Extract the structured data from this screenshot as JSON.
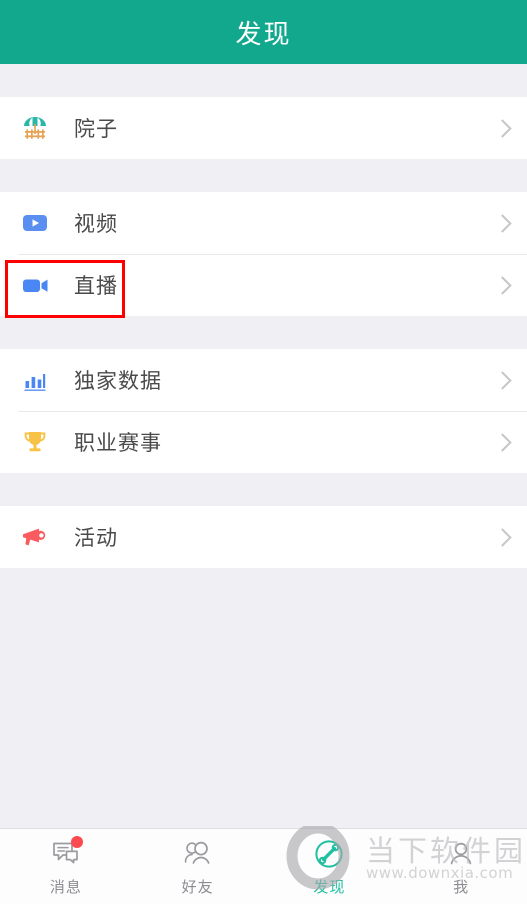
{
  "header": {
    "title": "发现"
  },
  "sections": [
    {
      "items": [
        {
          "label": "院子",
          "icon": "parasol-fence-icon",
          "accent": "#21b2a6"
        }
      ]
    },
    {
      "items": [
        {
          "label": "视频",
          "icon": "video-play-icon",
          "accent": "#5a8ef0"
        },
        {
          "label": "直播",
          "icon": "live-camera-icon",
          "accent": "#4a87f5",
          "highlighted": true
        }
      ]
    },
    {
      "items": [
        {
          "label": "独家数据",
          "icon": "bar-chart-icon",
          "accent": "#4a87f5"
        },
        {
          "label": "职业赛事",
          "icon": "trophy-icon",
          "accent": "#f7c245"
        }
      ]
    },
    {
      "items": [
        {
          "label": "活动",
          "icon": "megaphone-icon",
          "accent": "#fb5a5f"
        }
      ]
    }
  ],
  "chevron": {
    "icon": "chevron-right-icon"
  },
  "highlight": {
    "color": "#ff0000",
    "target": "直播"
  },
  "tabbar": {
    "items": [
      {
        "label": "消息",
        "icon": "message-bubble-icon",
        "active": false,
        "badge": true
      },
      {
        "label": "好友",
        "icon": "friends-icon",
        "active": false,
        "badge": false
      },
      {
        "label": "发现",
        "icon": "discover-bone-icon",
        "active": true,
        "badge": false
      },
      {
        "label": "我",
        "icon": "profile-icon",
        "active": false,
        "badge": false
      }
    ],
    "active_color": "#1fbfa0",
    "inactive_color": "#8c8c92"
  },
  "watermark": {
    "text": "当下软件园",
    "url": "www.downxia.com",
    "logo": "ring-logo"
  },
  "theme": {
    "header_bg": "#12a88e",
    "page_bg": "#efeff4",
    "row_bg": "#ffffff"
  }
}
